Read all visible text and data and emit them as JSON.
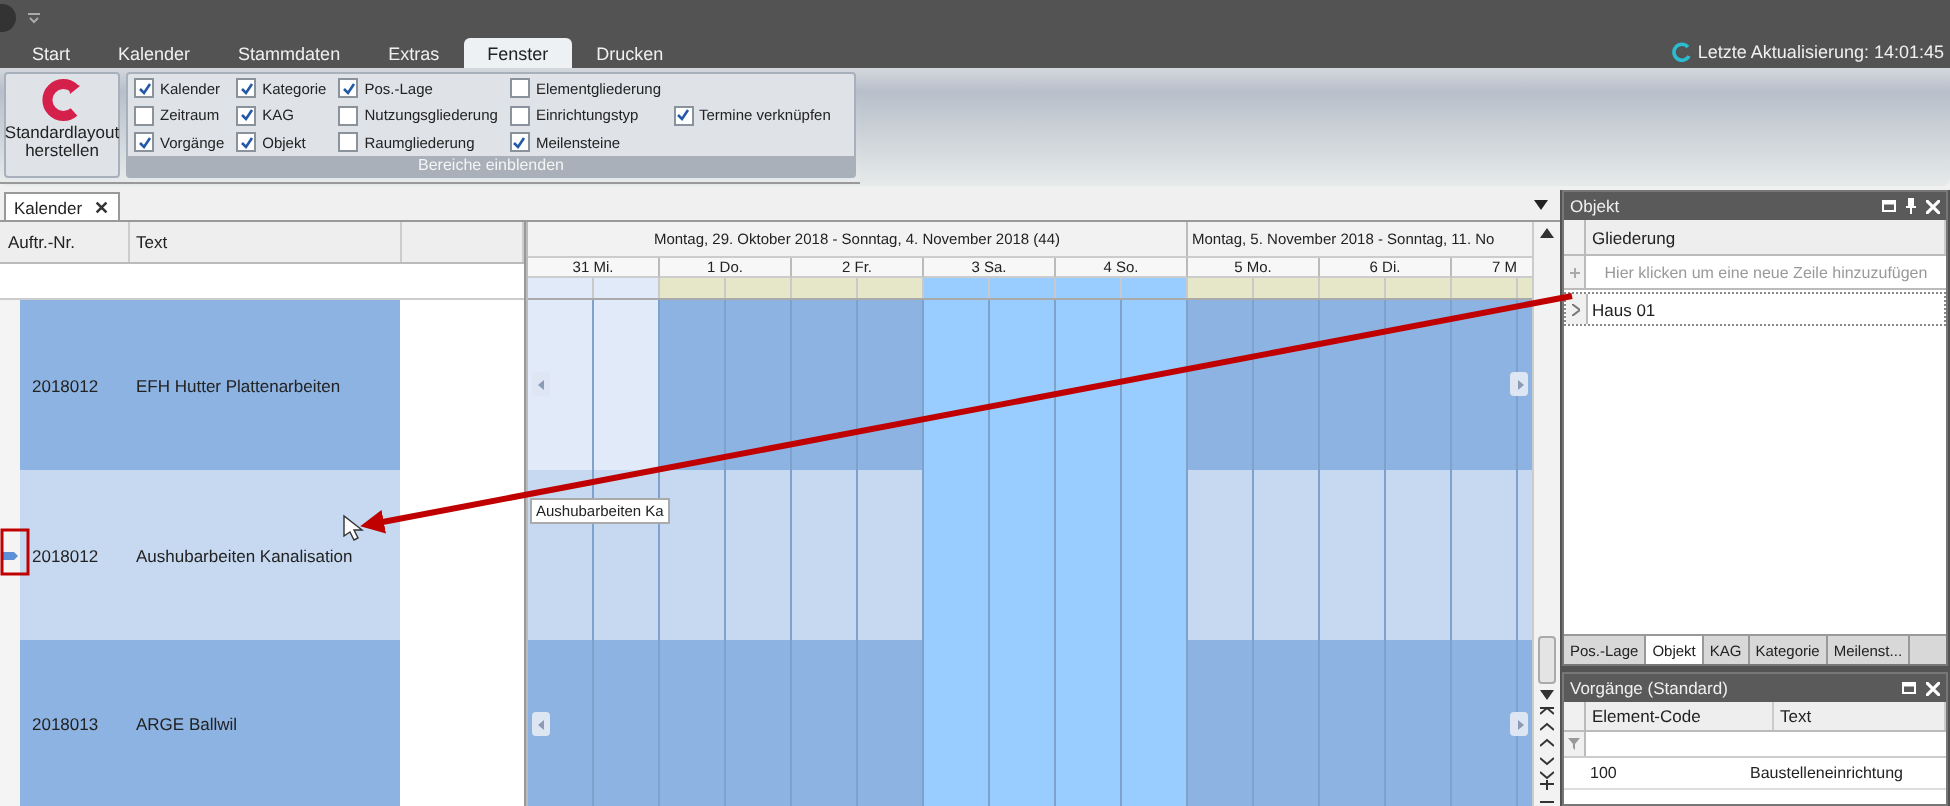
{
  "menu_tabs": [
    {
      "label": "Start",
      "selected": false
    },
    {
      "label": "Kalender",
      "selected": false
    },
    {
      "label": "Stammdaten",
      "selected": false
    },
    {
      "label": "Extras",
      "selected": false
    },
    {
      "label": "Fenster",
      "selected": true
    },
    {
      "label": "Drucken",
      "selected": false
    }
  ],
  "last_update": "Letzte Aktualisierung: 14:01:45",
  "ribbon": {
    "reset_button": "Standardlayout herstellen",
    "group_label": "Bereiche einblenden",
    "checkbox_columns": [
      [
        {
          "label": "Kalender",
          "checked": true
        },
        {
          "label": "Zeitraum",
          "checked": false
        },
        {
          "label": "Vorgänge",
          "checked": true
        }
      ],
      [
        {
          "label": "Kategorie",
          "checked": true
        },
        {
          "label": "KAG",
          "checked": true
        },
        {
          "label": "Objekt",
          "checked": true
        }
      ],
      [
        {
          "label": "Pos.-Lage",
          "checked": true
        },
        {
          "label": "Nutzungsgliederung",
          "checked": false
        },
        {
          "label": "Raumgliederung",
          "checked": false
        }
      ],
      [
        {
          "label": "Elementgliederung",
          "checked": false
        },
        {
          "label": "Einrichtungstyp",
          "checked": false
        },
        {
          "label": "Meilensteine",
          "checked": true
        }
      ],
      [
        {
          "label": "Termine verknüpfen",
          "checked": true
        }
      ]
    ]
  },
  "document_tab": {
    "label": "Kalender",
    "close": "✕"
  },
  "order_grid": {
    "columns": [
      "Auftr.-Nr.",
      "Text"
    ],
    "rows": [
      {
        "nr": "2018012",
        "text": "EFH Hutter Plattenarbeiten",
        "selected": false,
        "marked": false
      },
      {
        "nr": "2018012",
        "text": "Aushubarbeiten Kanalisation",
        "selected": true,
        "marked": true
      },
      {
        "nr": "2018013",
        "text": "ARGE Ballwil",
        "selected": false,
        "marked": false
      }
    ]
  },
  "calendar": {
    "weeks": [
      {
        "label": "Montag, 29. Oktober 2018 - Sonntag, 4. November 2018 (44)"
      },
      {
        "label": "Montag, 5. November 2018 - Sonntag, 11. No"
      }
    ],
    "days": [
      {
        "label": "31 Mi.",
        "weekend": false,
        "in_range": false
      },
      {
        "label": "1 Do.",
        "weekend": false,
        "in_range": true
      },
      {
        "label": "2 Fr.",
        "weekend": false,
        "in_range": true
      },
      {
        "label": "3 Sa.",
        "weekend": true,
        "in_range": true
      },
      {
        "label": "4 So.",
        "weekend": true,
        "in_range": true
      },
      {
        "label": "5 Mo.",
        "weekend": false,
        "in_range": true
      },
      {
        "label": "6 Di.",
        "weekend": false,
        "in_range": true
      },
      {
        "label": "7 M",
        "weekend": false,
        "in_range": true
      }
    ],
    "rows": [
      {
        "active": [
          false,
          true,
          true,
          true,
          true,
          true,
          true,
          true
        ]
      },
      {
        "active": [
          true,
          true,
          true,
          true,
          true,
          true,
          true,
          true
        ],
        "bar_label": "Aushubarbeiten Ka"
      },
      {
        "active": [
          true,
          true,
          true,
          true,
          true,
          true,
          true,
          true
        ]
      }
    ]
  },
  "object_panel": {
    "title": "Objekt",
    "column": "Gliederung",
    "placeholder": "Hier klicken um eine neue Zeile hinzuzufügen",
    "rows": [
      {
        "label": "Haus 01"
      }
    ],
    "tabs": [
      {
        "label": "Pos.-Lage",
        "selected": false
      },
      {
        "label": "Objekt",
        "selected": true
      },
      {
        "label": "KAG",
        "selected": false
      },
      {
        "label": "Kategorie",
        "selected": false
      },
      {
        "label": "Meilenst...",
        "selected": false
      }
    ]
  },
  "tasks_panel": {
    "title": "Vorgänge (Standard)",
    "columns": [
      "Element-Code",
      "Text"
    ],
    "rows": [
      {
        "code": "100",
        "text": "Baustelleneinrichtung"
      }
    ]
  }
}
